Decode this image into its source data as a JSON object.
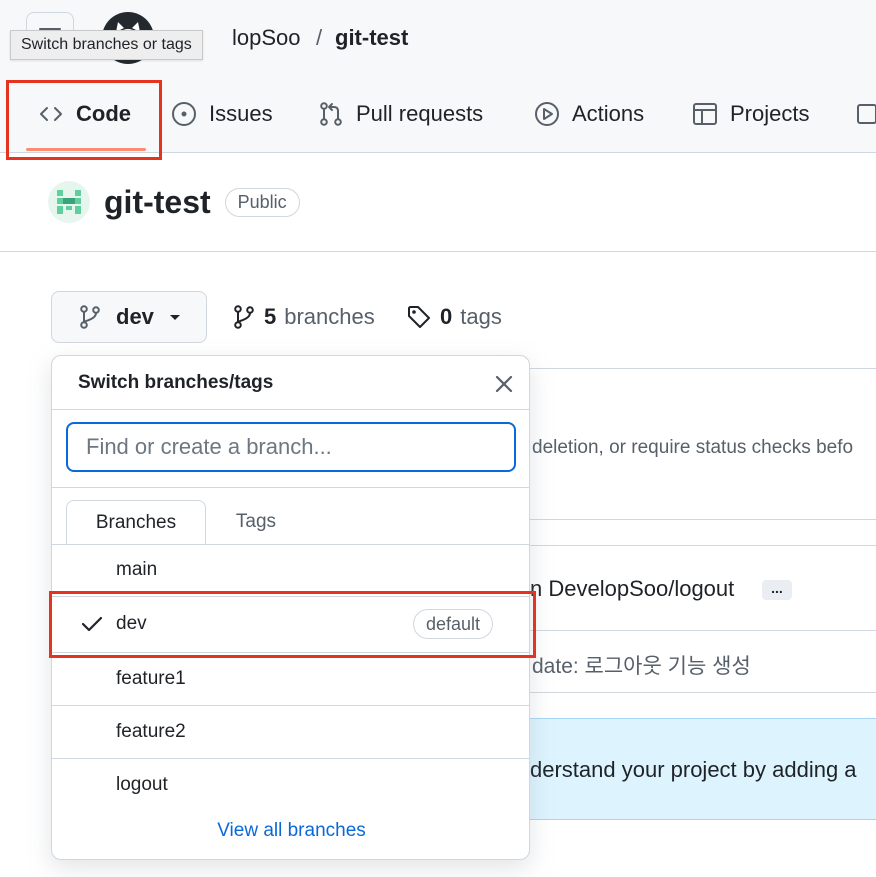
{
  "tooltip": "Switch branches or tags",
  "breadcrumb": {
    "owner": "lopSoo",
    "separator": "/",
    "repo": "git-test"
  },
  "tabs": [
    {
      "label": "Code",
      "icon": "code-icon"
    },
    {
      "label": "Issues",
      "icon": "issue-icon"
    },
    {
      "label": "Pull requests",
      "icon": "pull-request-icon"
    },
    {
      "label": "Actions",
      "icon": "play-icon"
    },
    {
      "label": "Projects",
      "icon": "table-icon"
    }
  ],
  "repo": {
    "name": "git-test",
    "visibility": "Public"
  },
  "branch_selector": {
    "current": "dev"
  },
  "stats": {
    "branches_count": "5",
    "branches_label": "branches",
    "tags_count": "0",
    "tags_label": "tags"
  },
  "background": {
    "protection_text": "deletion, or require status checks befo",
    "merge_text": "n DevelopSoo/logout",
    "ellipsis": "...",
    "commit_text": "date: 로그아웃 기능 생성",
    "readme_text": "derstand your project by adding a"
  },
  "dropdown": {
    "title": "Switch branches/tags",
    "search_placeholder": "Find or create a branch...",
    "tabs": [
      "Branches",
      "Tags"
    ],
    "branches": [
      {
        "name": "main"
      },
      {
        "name": "dev",
        "selected": true,
        "badge": "default"
      },
      {
        "name": "feature1"
      },
      {
        "name": "feature2"
      },
      {
        "name": "logout"
      }
    ],
    "view_all": "View all branches"
  },
  "colors": {
    "accent": "#0969da",
    "highlight_box": "#e5331f",
    "tab_underline": "#fd8c73"
  }
}
